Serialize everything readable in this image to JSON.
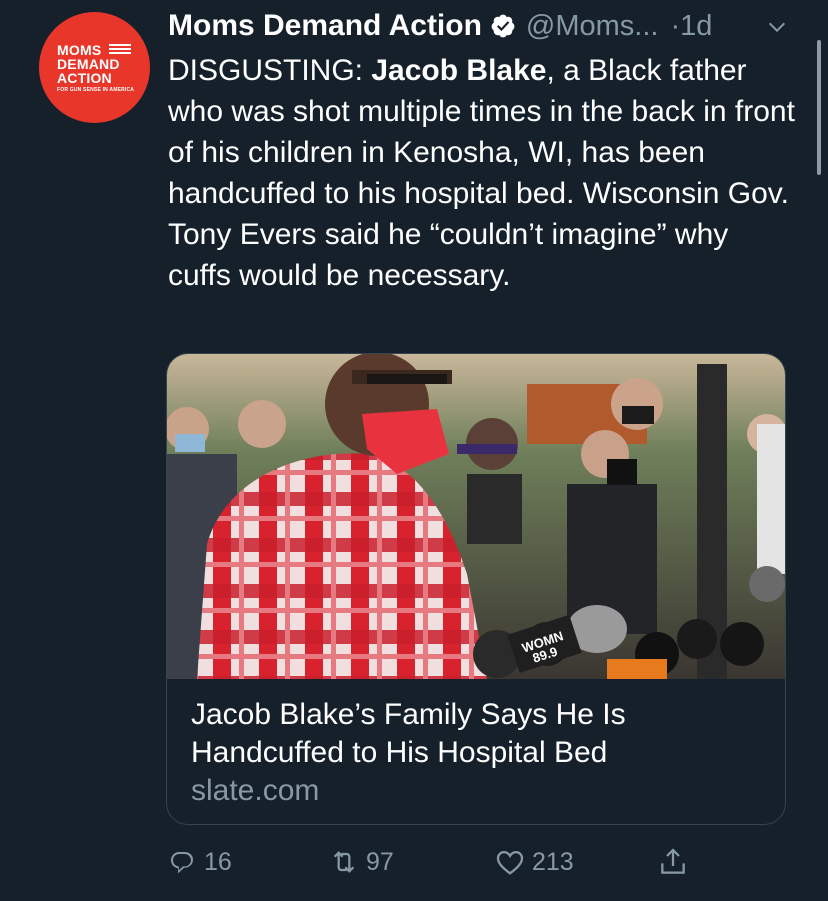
{
  "tweet": {
    "author_name": "Moms Demand Action",
    "handle": "@Moms...",
    "time": "·1d",
    "text_prefix": "DISGUSTING: ",
    "text_bold": "Jacob Blake",
    "text_suffix": ", a Black father who was shot multiple times in the back in front of his children in Kenosha, WI, has been handcuffed to his hospital bed. Wisconsin Gov. Tony Evers said he “couldn’t imagine” why cuffs would be necessary."
  },
  "avatar_logo": {
    "line1": "MOMS",
    "line2": "DEMAND",
    "line3": "ACTION",
    "tagline": "FOR GUN SENSE IN AMERICA"
  },
  "card": {
    "title": "Jacob Blake’s Family Says He Is Handcuffed to His Hospital Bed",
    "domain": "slate.com",
    "mic_label_1": "WOMN",
    "mic_label_2": "89.9"
  },
  "actions": {
    "replies": "16",
    "retweets": "97",
    "likes": "213"
  },
  "colors": {
    "background": "#15202b",
    "secondary_text": "#8899a6",
    "avatar_red": "#e8372a",
    "card_border": "#38444d"
  }
}
